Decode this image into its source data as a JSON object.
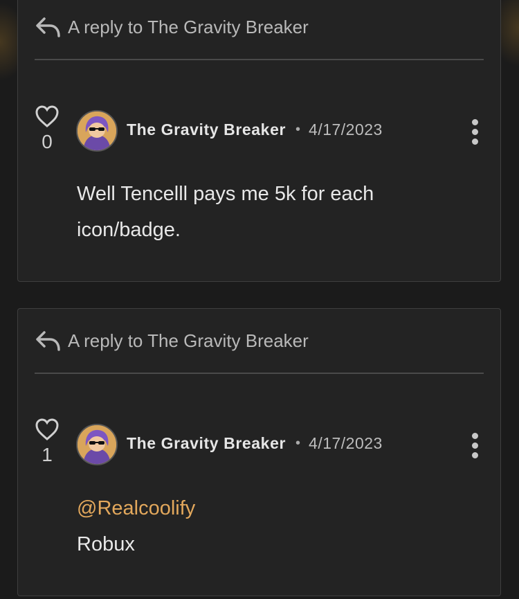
{
  "comments": [
    {
      "reply_label": "A reply to The Gravity Breaker",
      "likes": "0",
      "author": "The Gravity Breaker",
      "separator": "•",
      "date": "4/17/2023",
      "body_line1": "Well Tencelll pays me 5k for each",
      "body_line2": "icon/badge.",
      "avatar_icon": "avatar-icon",
      "heart_icon": "heart-outline-icon",
      "more_icon": "kebab-menu-icon",
      "reply_icon": "reply-arrow-icon"
    },
    {
      "reply_label": "A reply to The Gravity Breaker",
      "likes": "1",
      "author": "The Gravity Breaker",
      "separator": "•",
      "date": "4/17/2023",
      "mention": "@Realcoolify",
      "body_line2": "Robux",
      "avatar_icon": "avatar-icon",
      "heart_icon": "heart-outline-icon",
      "more_icon": "kebab-menu-icon",
      "reply_icon": "reply-arrow-icon"
    }
  ],
  "colors": {
    "background": "#1b1b1b",
    "card": "#232323",
    "mention": "#e3a85c"
  }
}
